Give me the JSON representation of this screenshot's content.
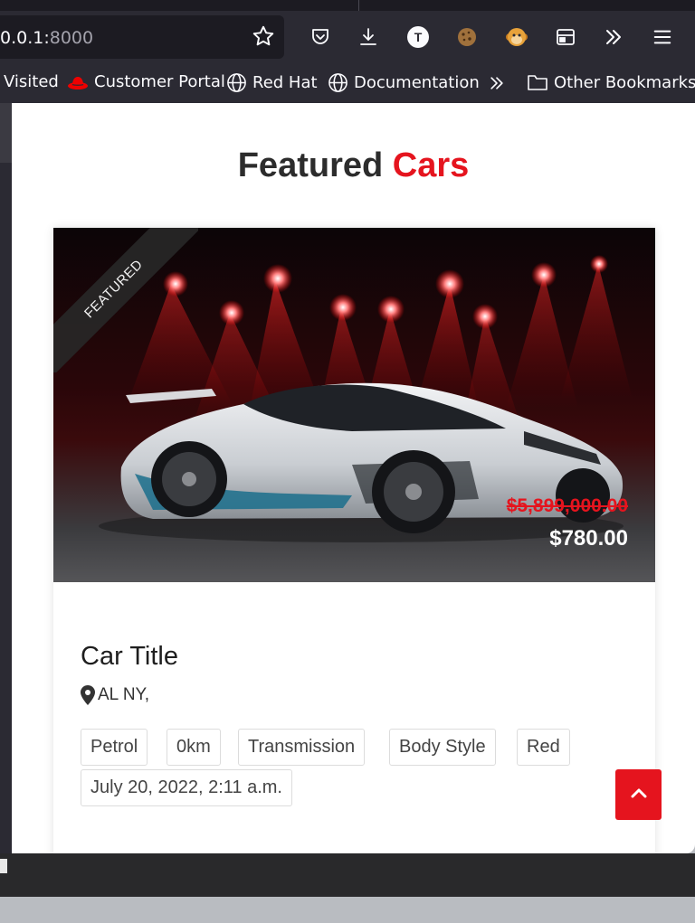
{
  "browser": {
    "url_host": "0.0.1:",
    "url_port": "8000",
    "toolbar_icons": [
      "star-icon",
      "pocket-icon",
      "download-icon",
      "account-icon",
      "cookie-icon",
      "monkey-icon",
      "container-icon",
      "overflow-chevrons-icon",
      "menu-icon"
    ],
    "account_initial": "T"
  },
  "bookmarks": [
    {
      "label": "Visited",
      "icon": "none"
    },
    {
      "label": "Customer Portal",
      "icon": "redhat-icon"
    },
    {
      "label": "Red Hat",
      "icon": "globe-icon"
    },
    {
      "label": "Documentation",
      "icon": "globe-icon"
    },
    {
      "label": "Other Bookmarks",
      "icon": "folder-icon"
    }
  ],
  "section": {
    "title_main": "Featured",
    "title_accent": "Cars"
  },
  "colors": {
    "accent": "#e5141e",
    "chrome": "#2b2a33",
    "urlbar": "#1c1b22"
  },
  "card": {
    "ribbon": "FEATURED",
    "old_price": "$5,899,000.00",
    "price": "$780.00",
    "title": "Car Title",
    "location": "AL NY,",
    "chips": [
      "Petrol",
      "0km",
      "Transmission",
      "Body Style",
      "Red",
      "July 20, 2022, 2:11 a.m."
    ]
  }
}
